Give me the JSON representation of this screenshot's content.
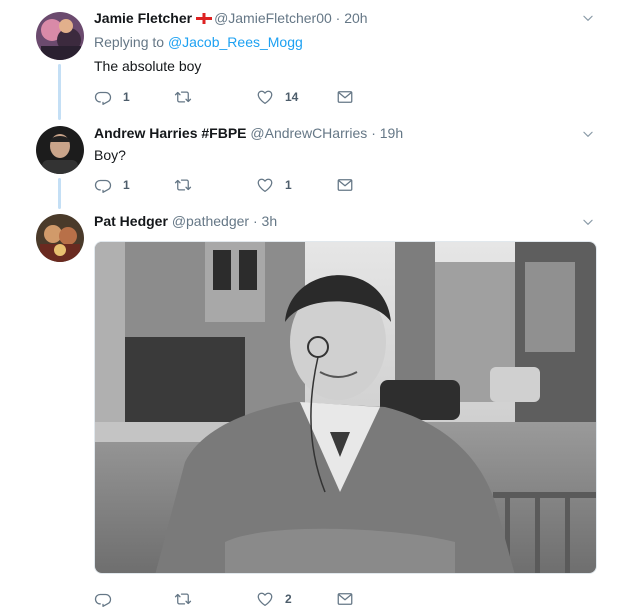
{
  "tweets": [
    {
      "name": "Jamie Fletcher",
      "flag": "england-flag-icon",
      "handle": "@JamieFletcher00",
      "separator": "·",
      "time": "20h",
      "replying_prefix": "Replying to",
      "replying_mention": "@Jacob_Rees_Mogg",
      "text": "The absolute boy",
      "replies": "1",
      "retweets": "",
      "likes": "14"
    },
    {
      "name": "Andrew Harries #FBPE",
      "handle": "@AndrewCHarries",
      "separator": "·",
      "time": "19h",
      "text": "Boy?",
      "replies": "1",
      "retweets": "",
      "likes": "1"
    },
    {
      "name": "Pat Hedger",
      "handle": "@pathedger",
      "separator": "·",
      "time": "3h",
      "replies": "",
      "retweets": "",
      "likes": "2"
    }
  ],
  "icons": {
    "reply": "reply-icon",
    "retweet": "retweet-icon",
    "like": "heart-icon",
    "message": "envelope-icon",
    "more": "chevron-down-icon"
  },
  "colors": {
    "link": "#1da1f2",
    "thread_line": "#c4dff5",
    "muted": "#657786"
  }
}
